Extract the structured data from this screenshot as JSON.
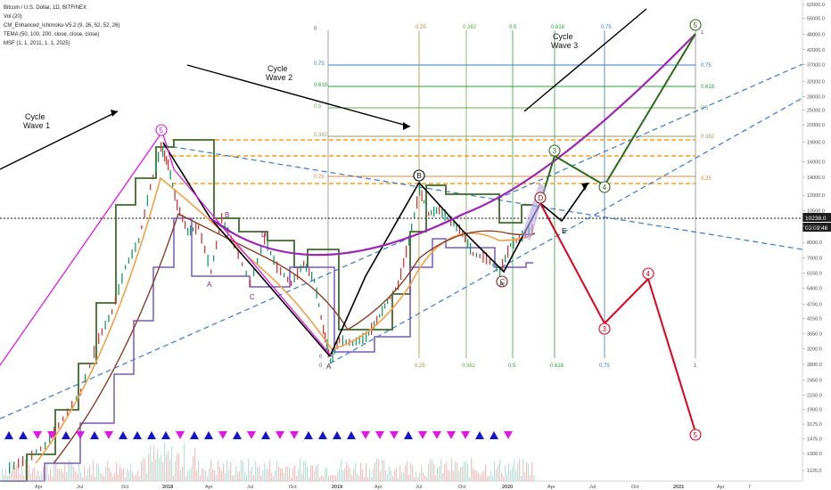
{
  "header": {
    "title": "Bitcoin / U.S. Dollar, 1D, BITFINEX",
    "indicators": [
      "Vol (20)",
      "CM_Enhanced_Ichimoku-V5.2 (9, 26, 52, 52, 26)",
      "TEMA (50, 100, 200, close, close, close)",
      "MSF (1, 1, 2011, 1, 1, 2025)"
    ]
  },
  "price_badges": {
    "price": "10238.0",
    "countdown": "03:09:46"
  },
  "colors": {
    "purple_arc": "#9c27b0",
    "projection": "#e0001b",
    "green_path": "#2e6b1e",
    "black_path": "#000000",
    "magenta": "#e01be0",
    "trend_blue": "#3a78c9",
    "fib_orange": "#f3a11a"
  },
  "chart_data": {
    "type": "line",
    "scale": "log",
    "y_ticks": [
      62000,
      55000,
      48000,
      42000,
      37000,
      32000,
      28000,
      25000,
      22000,
      19000,
      16000,
      14000,
      12000,
      10500,
      9200,
      8000,
      7000,
      6150,
      5400,
      4700,
      4150,
      3650,
      3200,
      2800,
      2450,
      2150,
      1900,
      1675,
      1475,
      1300,
      1125
    ],
    "x_ticks": [
      "Apr",
      "Jul",
      "Oct",
      "2018",
      "Apr",
      "Jul",
      "Oct",
      "2019",
      "Apr",
      "Jul",
      "Oct",
      "2020",
      "Apr",
      "Jul",
      "Oct",
      "2021",
      "Apr",
      "7"
    ],
    "fib_sets": [
      {
        "name": "fib_top_left",
        "levels": [
          "0",
          "0.75",
          "0.618",
          "0.5",
          "0.382",
          "0.25"
        ]
      },
      {
        "name": "fib_top_right",
        "levels": [
          "1",
          "0.75",
          "0.618",
          "0.5",
          "0.382",
          "0.25"
        ]
      },
      {
        "name": "fib_time_top",
        "levels": [
          "0.25",
          "0.382",
          "0.5",
          "0.618",
          "0.75"
        ]
      },
      {
        "name": "fib_time_bottom",
        "levels": [
          "0",
          "0.25",
          "0.382",
          "0.5",
          "0.618",
          "0.75",
          "1"
        ]
      }
    ],
    "wave_titles": [
      {
        "text": "Cycle\nWave 1"
      },
      {
        "text": "Cycle\nWave 2"
      },
      {
        "text": "Cycle\nWave 3"
      }
    ],
    "wave_labels_circled": [
      "5",
      "B",
      "C",
      "3",
      "4",
      "5",
      "D",
      "3",
      "4",
      "5"
    ],
    "wave_labels_plain": [
      "A",
      "B",
      "C",
      "D",
      "A",
      "E",
      "A"
    ],
    "annotations": [
      "0"
    ]
  }
}
